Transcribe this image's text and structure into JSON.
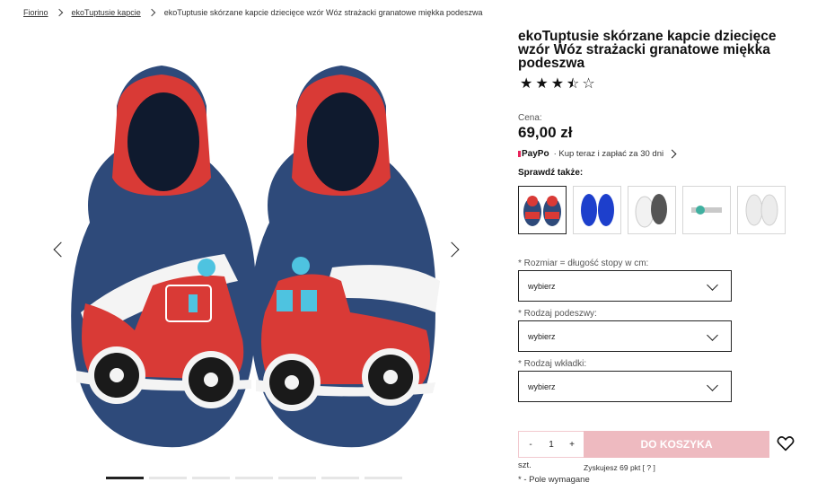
{
  "breadcrumb": [
    "Fiorino",
    "ekoTuptusie kapcie",
    "ekoTuptusie skórzane kapcie dziecięce wzór Wóz strażacki granatowe miękka podeszwa"
  ],
  "product": {
    "title": "ekoTuptusie skórzane kapcie dziecięce wzór Wóz strażacki granatowe miękka podeszwa",
    "rating": 3.5,
    "rating_max": 5,
    "price_label": "Cena:",
    "price": "69,00 zł"
  },
  "paypo": {
    "logo": "PayPo",
    "text": "· Kup teraz i zapłać za 30 dni"
  },
  "see_also": {
    "label": "Sprawdź także:",
    "items": [
      "firetruck-slippers",
      "blue-insoles",
      "white-gray-soles",
      "tape-roll",
      "sheepskin-insoles"
    ]
  },
  "fields": [
    {
      "label": "* Rozmiar = długość stopy w cm:",
      "value": "wybierz"
    },
    {
      "label": "* Rodzaj podeszwy:",
      "value": "wybierz"
    },
    {
      "label": "* Rodzaj wkładki:",
      "value": "wybierz"
    }
  ],
  "purchase": {
    "minus": "-",
    "quantity": "1",
    "plus": "+",
    "cart_button": "DO KOSZYKA",
    "unit": "szt.",
    "points": "Zyskujesz 69 pkt [  ?  ]",
    "required_note": "* - Pole wymagane"
  },
  "gallery": {
    "slides": 7,
    "active_slide": 0
  },
  "colors": {
    "accent": "#eebac0",
    "text": "#111111",
    "navy": "#2e4a7a",
    "red": "#d93a36"
  }
}
